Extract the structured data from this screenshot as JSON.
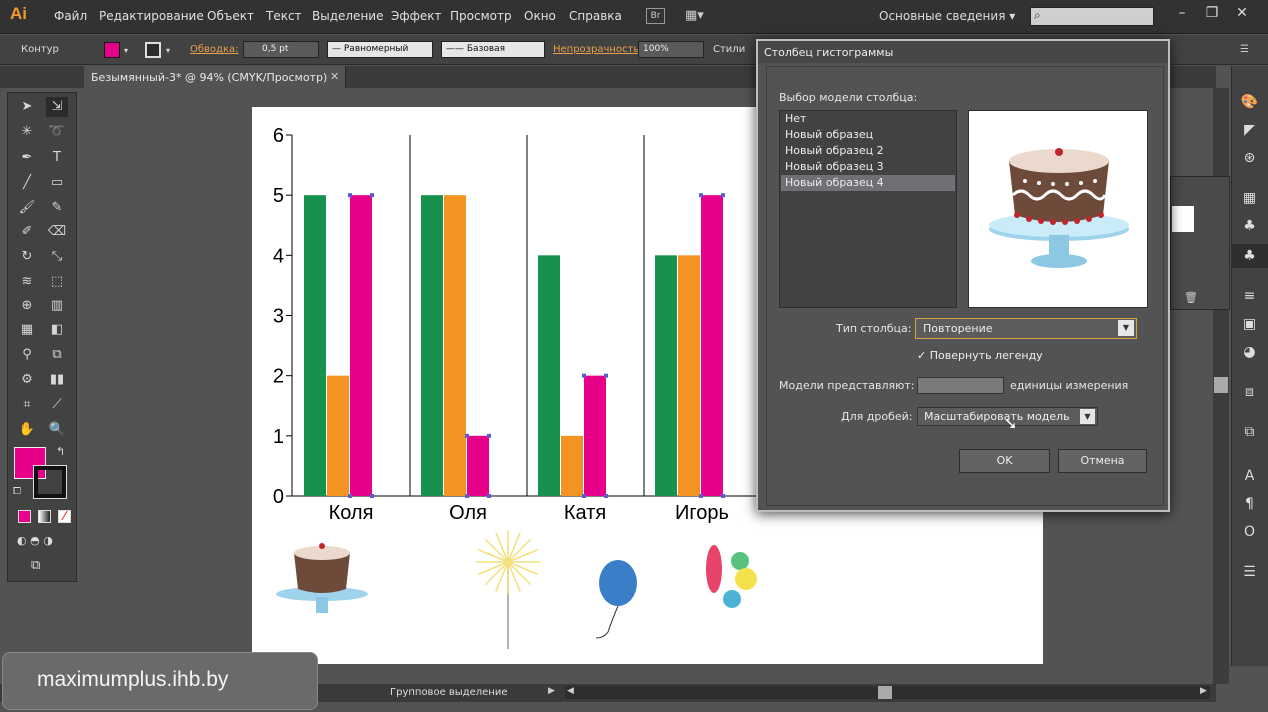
{
  "app": {
    "logo": "Ai"
  },
  "menu": [
    "Файл",
    "Редактирование",
    "Объект",
    "Текст",
    "Выделение",
    "Эффект",
    "Просмотр",
    "Окно",
    "Справка"
  ],
  "header": {
    "bridge": "Br",
    "workspace": "Основные сведения"
  },
  "control": {
    "mode": "Контур",
    "stroke_label": "Обводка:",
    "stroke_weight": "0,5 pt",
    "profile": "Равномерный",
    "brush": "Базовая",
    "opacity_label": "Непрозрачность:",
    "opacity_value": "100%",
    "styles_label": "Стили"
  },
  "document": {
    "tab_title": "Безымянный-3* @ 94% (CMYK/Просмотр)"
  },
  "status": {
    "text": "Групповое выделение"
  },
  "watermark": "maximumplus.ihb.by",
  "dialog": {
    "title": "Столбец гистограммы",
    "list_caption": "Выбор модели столбца:",
    "patterns": [
      "Нет",
      "Новый образец",
      "Новый образец 2",
      "Новый образец 3",
      "Новый образец 4"
    ],
    "selected_index": 4,
    "type_label": "Тип столбца:",
    "type_value": "Повторение",
    "rotate_label": "Повернуть легенду",
    "rotate_checked": true,
    "units_label": "Модели представляют:",
    "units_value": "",
    "units_suffix": "единицы измерения",
    "fraction_label": "Для дробей:",
    "fraction_value": "Масштабировать модель",
    "ok_label": "OK",
    "cancel_label": "Отмена"
  },
  "colors": {
    "green": "#16924e",
    "orange": "#f39322",
    "magenta": "#e6008a",
    "fill_swatch": "#e6008a"
  },
  "chart_data": {
    "type": "bar",
    "categories": [
      "Коля",
      "Оля",
      "Катя",
      "Игорь"
    ],
    "series": [
      {
        "values": [
          5,
          5,
          4,
          4
        ]
      },
      {
        "values": [
          2,
          5,
          1,
          4
        ]
      },
      {
        "values": [
          5,
          1,
          2,
          5
        ]
      }
    ],
    "yticks": [
      "0",
      "1",
      "2",
      "3",
      "4",
      "5",
      "6"
    ],
    "ylim": [
      0,
      6
    ]
  }
}
